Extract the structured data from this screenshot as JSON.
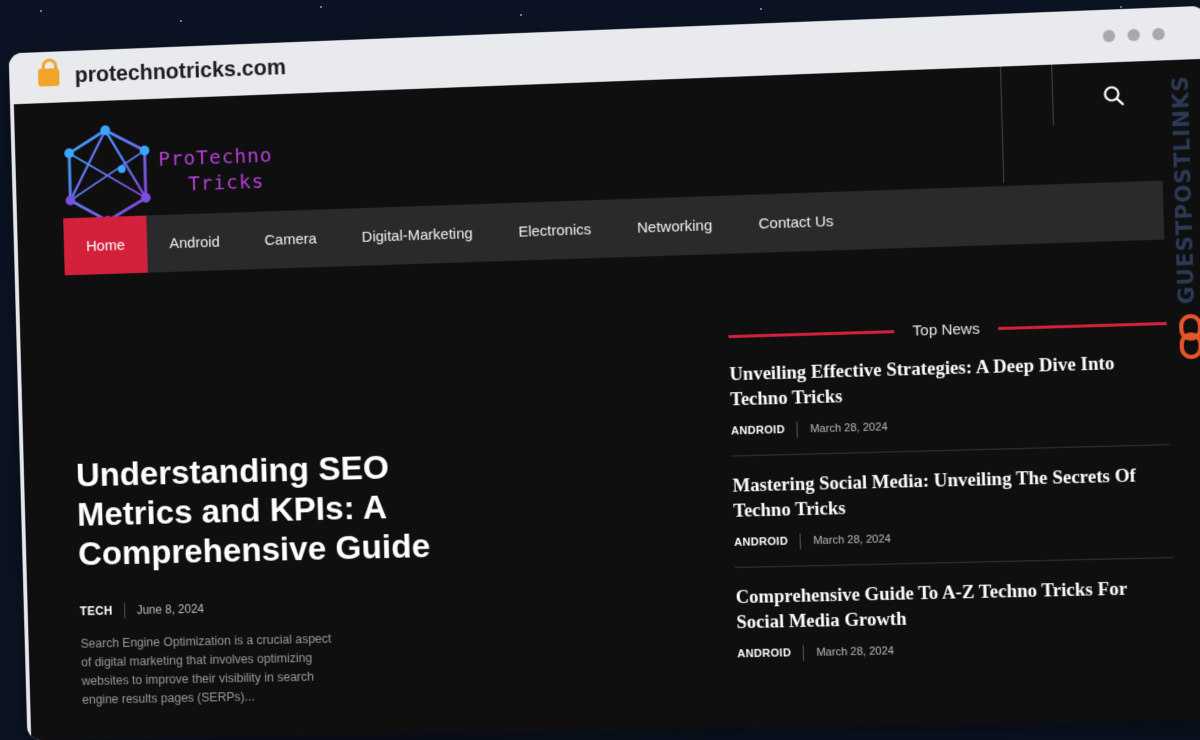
{
  "browser": {
    "url": "protechnotricks.com"
  },
  "logo": {
    "line1": "ProTechno",
    "line2": "Tricks"
  },
  "nav": {
    "items": [
      {
        "label": "Home"
      },
      {
        "label": "Android"
      },
      {
        "label": "Camera"
      },
      {
        "label": "Digital-Marketing"
      },
      {
        "label": "Electronics"
      },
      {
        "label": "Networking"
      },
      {
        "label": "Contact Us"
      }
    ]
  },
  "side_brand": "GUESTPOSTLINKS",
  "hero": {
    "title": "Understanding SEO Metrics and KPIs: A Comprehensive Guide",
    "category": "TECH",
    "date": "June 8, 2024",
    "excerpt": "Search Engine Optimization is a crucial aspect of digital marketing that involves optimizing websites to improve their visibility in search engine results pages (SERPs)..."
  },
  "top_news": {
    "heading": "Top News",
    "items": [
      {
        "title": "Unveiling Effective Strategies: A Deep Dive Into Techno Tricks",
        "category": "ANDROID",
        "date": "March 28, 2024"
      },
      {
        "title": "Mastering Social Media: Unveiling The Secrets Of Techno Tricks",
        "category": "ANDROID",
        "date": "March 28, 2024"
      },
      {
        "title": "Comprehensive Guide To A-Z Techno Tricks For Social Media Growth",
        "category": "ANDROID",
        "date": "March 28, 2024"
      }
    ]
  },
  "colors": {
    "accent": "#d3213b",
    "background": "#0f0f10",
    "nav": "#2a2a2c",
    "logo": "#b33fd6"
  }
}
